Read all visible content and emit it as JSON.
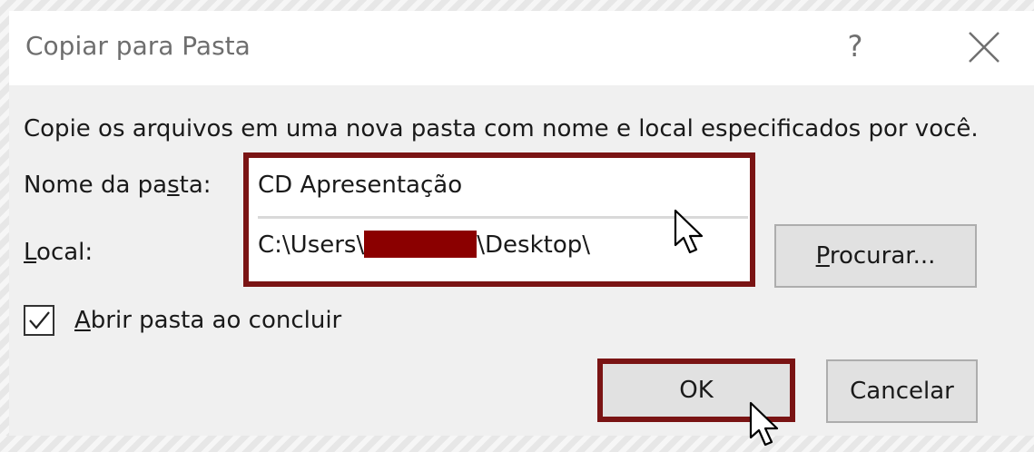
{
  "window": {
    "title": "Copiar para Pasta",
    "help_label": "?"
  },
  "description": "Copie os arquivos em uma nova pasta com nome e local especificados por você.",
  "folder_name": {
    "label": "Nome da pasta:",
    "value": "CD Apresentação"
  },
  "location": {
    "label": "Local:",
    "value_prefix": "C:\\Users\\",
    "value_suffix": "\\Desktop\\"
  },
  "browse_button": {
    "label": "Procurar..."
  },
  "open_folder_checkbox": {
    "label": "Abrir pasta ao concluir",
    "checked": true
  },
  "buttons": {
    "ok_label": "OK",
    "cancel_label": "Cancelar"
  },
  "colors": {
    "highlight_border": "#7a1414",
    "redaction": "#8b0000",
    "dialog_background": "#f0f0f0"
  },
  "icons": {
    "close": "close-icon",
    "check": "checkmark-icon",
    "pointer": "mouse-pointer-icon"
  }
}
